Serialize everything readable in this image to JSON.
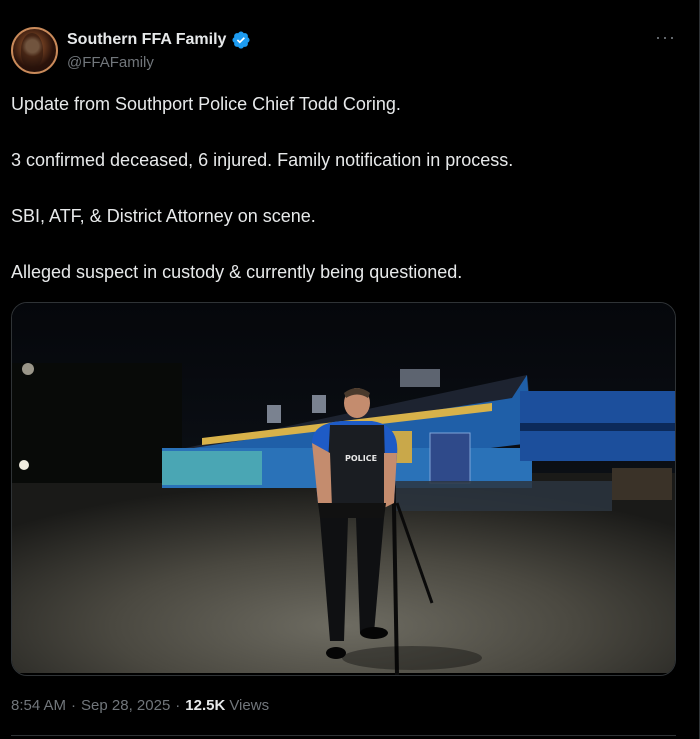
{
  "author": {
    "display_name": "Southern FFA Family",
    "handle": "@FFAFamily",
    "verified": true,
    "avatar_icon": "profile-photo-avatar"
  },
  "more_icon": "more-horizontal-icon",
  "tweet": {
    "paragraphs": [
      "Update from Southport Police Chief Todd Coring.",
      "3 confirmed deceased, 6 injured. Family notification in process.",
      "SBI, ATF, & District Attorney on scene.",
      "Alleged suspect in custody & currently being questioned."
    ]
  },
  "media": {
    "type": "video-still",
    "vest_text": "POLICE"
  },
  "meta": {
    "time": "8:54 AM",
    "date": "Sep 28, 2025",
    "separator": "·",
    "views_count": "12.5K",
    "views_label": "Views"
  },
  "colors": {
    "background": "#000000",
    "text": "#e7e9ea",
    "secondary": "#71767b",
    "verified": "#1d9bf0",
    "border": "#2f3336"
  }
}
